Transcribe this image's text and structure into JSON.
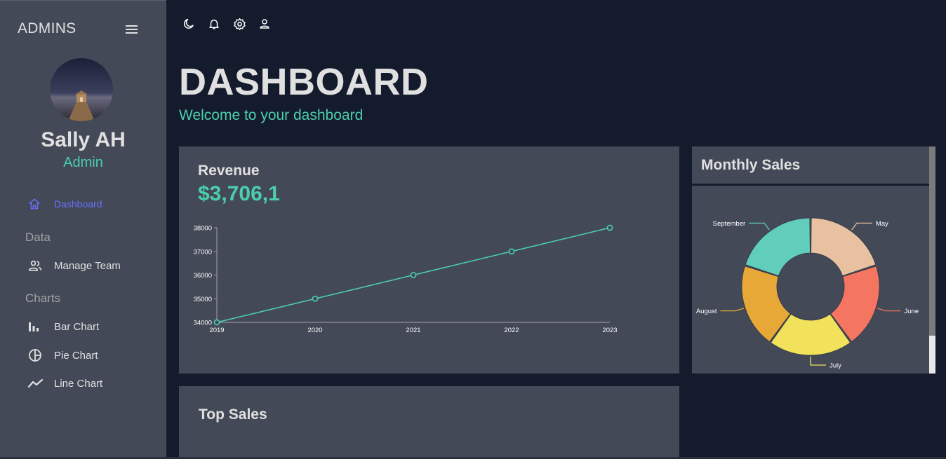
{
  "sidebar": {
    "brand": "ADMINS",
    "user_name": "Sally AH",
    "user_role": "Admin",
    "dashboard_label": "Dashboard",
    "section_data": "Data",
    "manage_team_label": "Manage Team",
    "section_charts": "Charts",
    "bar_chart_label": "Bar Chart",
    "pie_chart_label": "Pie Chart",
    "line_chart_label": "Line Chart"
  },
  "topbar": {
    "icons": [
      "dark-mode-icon",
      "notifications-icon",
      "settings-icon",
      "profile-icon"
    ]
  },
  "header": {
    "title": "DASHBOARD",
    "subtitle": "Welcome to your dashboard"
  },
  "revenue": {
    "title": "Revenue",
    "value": "$3,706,1"
  },
  "monthly_sales": {
    "title": "Monthly Sales"
  },
  "top_sales": {
    "title": "Top Sales"
  },
  "colors": {
    "accent": "#4cceac",
    "active_nav": "#6870fa",
    "background": "#141b2d",
    "panel": "#434957"
  },
  "chart_data": [
    {
      "type": "line",
      "x": [
        "2019",
        "2020",
        "2021",
        "2022",
        "2023"
      ],
      "series": [
        {
          "values": [
            34000,
            35000,
            36000,
            37000,
            38000
          ]
        }
      ],
      "y_ticks": [
        34000,
        35000,
        36000,
        37000,
        38000
      ],
      "ylim": [
        34000,
        38000
      ],
      "grid": false,
      "color": "#4cceac"
    },
    {
      "type": "pie",
      "donut": true,
      "categories": [
        "May",
        "June",
        "July",
        "August",
        "September"
      ],
      "values": [
        20,
        20,
        20,
        20,
        20
      ],
      "colors": [
        "#e8c1a0",
        "#f47560",
        "#f1e15b",
        "#e8a838",
        "#61cdbb"
      ]
    }
  ]
}
